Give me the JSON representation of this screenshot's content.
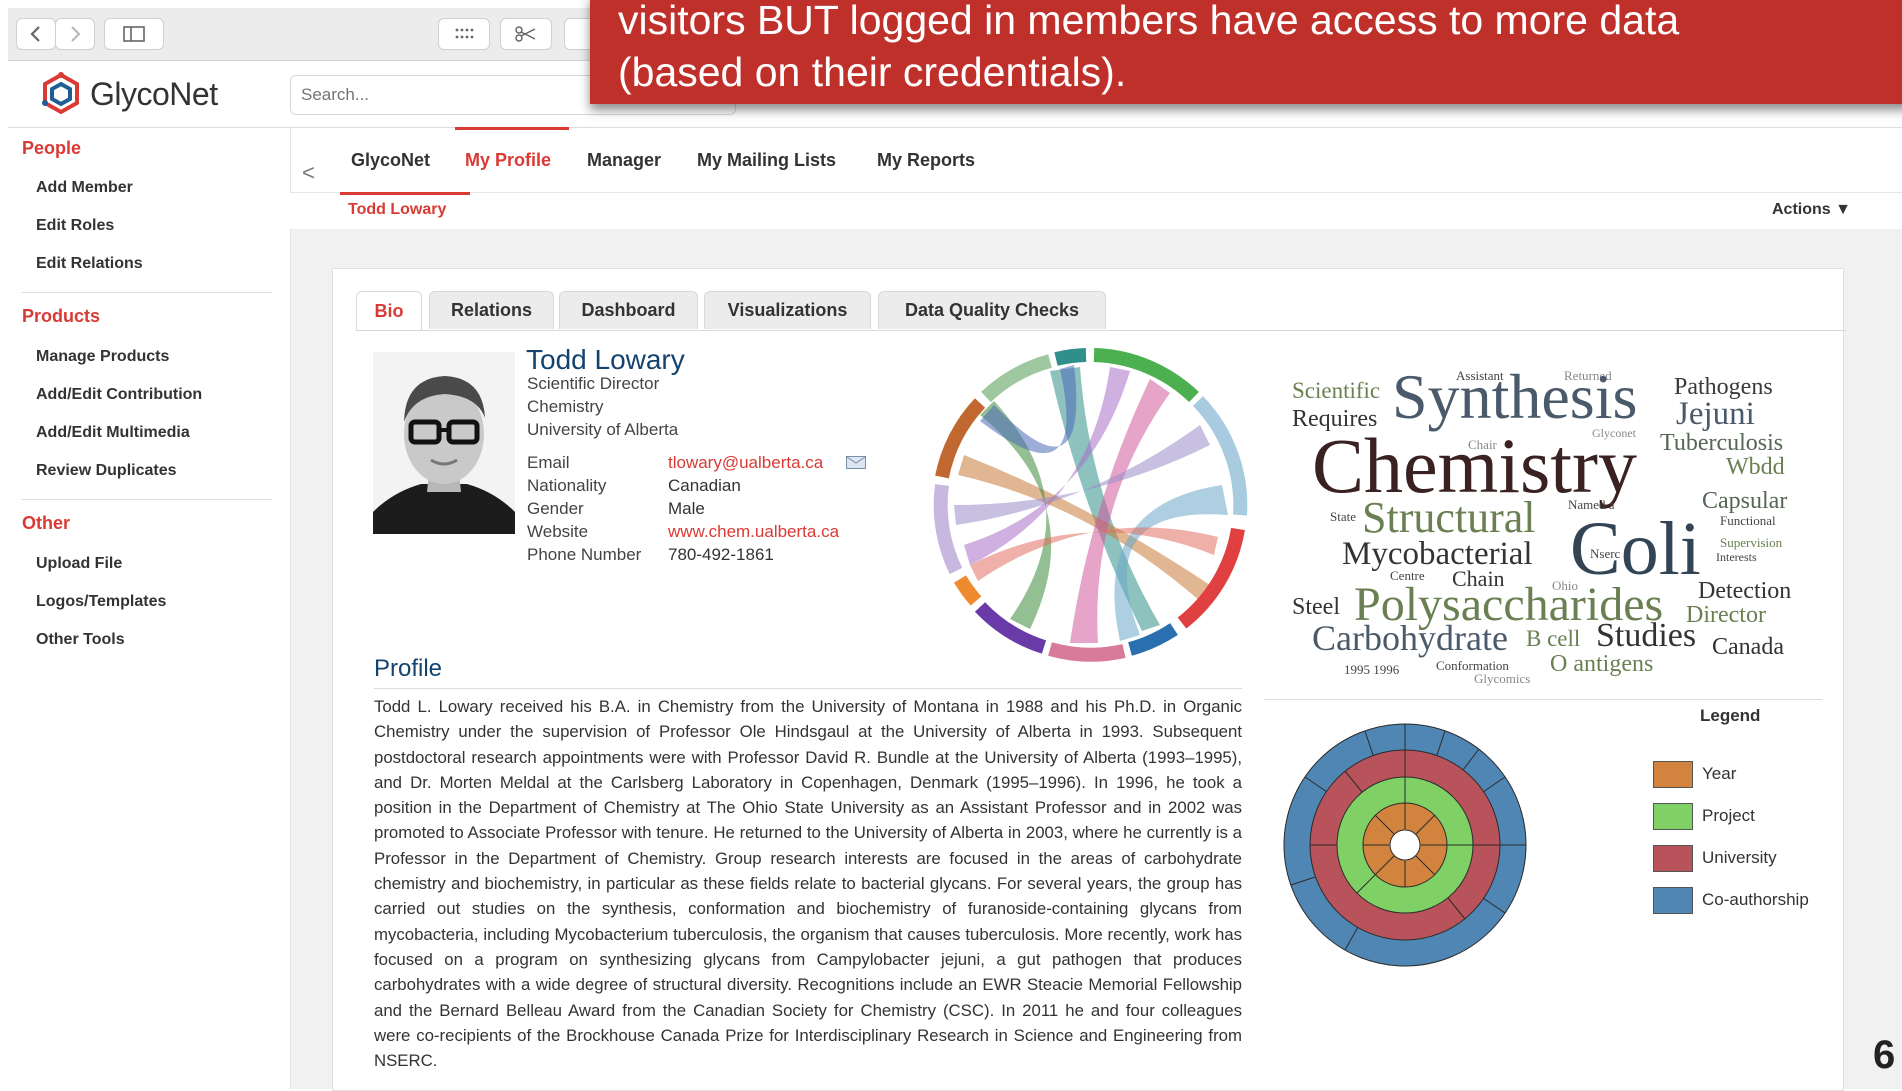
{
  "banner": {
    "line1": "visitors BUT logged in members have access to more data",
    "line2": "(based on their credentials)."
  },
  "app": {
    "name": "GlycoNet",
    "search_placeholder": "Search..."
  },
  "sidebar": {
    "sections": [
      {
        "title": "People",
        "items": [
          "Add Member",
          "Edit Roles",
          "Edit Relations"
        ]
      },
      {
        "title": "Products",
        "items": [
          "Manage Products",
          "Add/Edit Contribution",
          "Add/Edit Multimedia",
          "Review Duplicates"
        ]
      },
      {
        "title": "Other",
        "items": [
          "Upload File",
          "Logos/Templates",
          "Other Tools"
        ]
      }
    ]
  },
  "nav": {
    "collapse": "<",
    "tabs": [
      "GlycoNet",
      "My Profile",
      "Manager",
      "My Mailing Lists",
      "My Reports"
    ],
    "active": "My Profile",
    "breadcrumb": "Todd Lowary",
    "actions": "Actions ▼"
  },
  "profile_tabs": [
    "Bio",
    "Relations",
    "Dashboard",
    "Visualizations",
    "Data Quality Checks"
  ],
  "person": {
    "name": "Todd Lowary",
    "title": "Scientific Director",
    "department": "Chemistry",
    "university": "University of Alberta",
    "fields": [
      {
        "label": "Email",
        "value": "tlowary@ualberta.ca",
        "link": true
      },
      {
        "label": "Nationality",
        "value": "Canadian",
        "link": false
      },
      {
        "label": "Gender",
        "value": "Male",
        "link": false
      },
      {
        "label": "Website",
        "value": "www.chem.ualberta.ca",
        "link": true
      },
      {
        "label": "Phone Number",
        "value": "780-492-1861",
        "link": false
      }
    ]
  },
  "profile": {
    "title": "Profile",
    "text": "Todd L. Lowary received his B.A. in Chemistry from the University of Montana in 1988 and his Ph.D. in Organic Chemistry under the supervision of Professor Ole Hindsgaul at the University of Alberta in 1993. Subsequent postdoctoral research appointments were with Professor David R. Bundle at the University of Alberta (1993–1995), and Dr. Morten Meldal at the Carlsberg Laboratory in Copenhagen, Denmark (1995–1996). In 1996, he took a position in the Department of Chemistry at The Ohio State University as an Assistant Professor and in 2002 was promoted to Associate Professor with tenure. He returned to the University of Alberta in 2003, where he currently is a Professor in the Department of Chemistry. Group research interests are focused in the areas of carbohydrate chemistry and biochemistry, in particular as these fields relate to bacterial glycans. For several years, the group has carried out studies on the synthesis, conformation and biochemistry of furanoside-containing glycans from mycobacteria, including Mycobacterium tuberculosis, the organism that causes tuberculosis. More recently, work has focused on a program on synthesizing glycans from Campylobacter jejuni, a gut pathogen that produces carbohydrates with a wide degree of structural diversity. Recognitions include an EWR Steacie Memorial Fellowship and the Bernard Belleau Award from the Canadian Society for Chemistry (CSC). In 2011 he and four colleagues were co-recipients of the Brockhouse Canada Prize for Interdisciplinary Research in Science and Engineering from NSERC."
  },
  "wordcloud": {
    "words": [
      "Scientific",
      "Assistant",
      "Returned",
      "Synthesis",
      "Pathogens",
      "Requires",
      "Jejuni",
      "Glyconet",
      "Chair",
      "Tuberculosis",
      "Chemistry",
      "Wbdd",
      "Named a",
      "Capsular",
      "State",
      "Structural",
      "Functional",
      "Coli",
      "Supervision",
      "Mycobacterial",
      "Nserc",
      "Interests",
      "Centre",
      "Chain",
      "Ohio",
      "Detection",
      "Steel",
      "Polysaccharides",
      "Director",
      "Carbohydrate",
      "B cell",
      "Studies",
      "Canada",
      "1995 1996",
      "Conformation",
      "Glycomics",
      "O antigens"
    ]
  },
  "legend": {
    "title": "Legend",
    "items": [
      {
        "label": "Year",
        "color": "#d2843f"
      },
      {
        "label": "Project",
        "color": "#7fd166"
      },
      {
        "label": "University",
        "color": "#b8535b"
      },
      {
        "label": "Co-authorship",
        "color": "#4f86b3"
      }
    ]
  },
  "page_number": "6"
}
